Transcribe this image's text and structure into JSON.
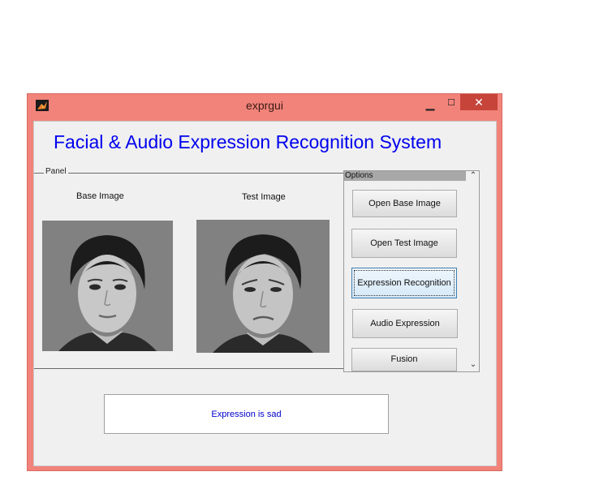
{
  "window": {
    "title": "exprgui",
    "minimize_glyph": "▁",
    "maximize_glyph": "☐",
    "close_glyph": "✕",
    "frame_color": "#f2837a",
    "close_color": "#c7443a"
  },
  "app": {
    "heading": "Facial & Audio Expression Recognition System",
    "heading_color": "#0000ee"
  },
  "panel": {
    "title": "Panel",
    "base_caption": "Base Image",
    "test_caption": "Test Image"
  },
  "options": {
    "title": "Options",
    "scroll_up_glyph": "⌃",
    "scroll_down_glyph": "⌄",
    "buttons": [
      {
        "label": "Open Base Image"
      },
      {
        "label": "Open Test Image"
      },
      {
        "label": "Expression Recognition"
      },
      {
        "label": "Audio Expression"
      },
      {
        "label": "Fusion"
      }
    ]
  },
  "result": {
    "text": "Expression is sad",
    "color": "#0000cc"
  }
}
